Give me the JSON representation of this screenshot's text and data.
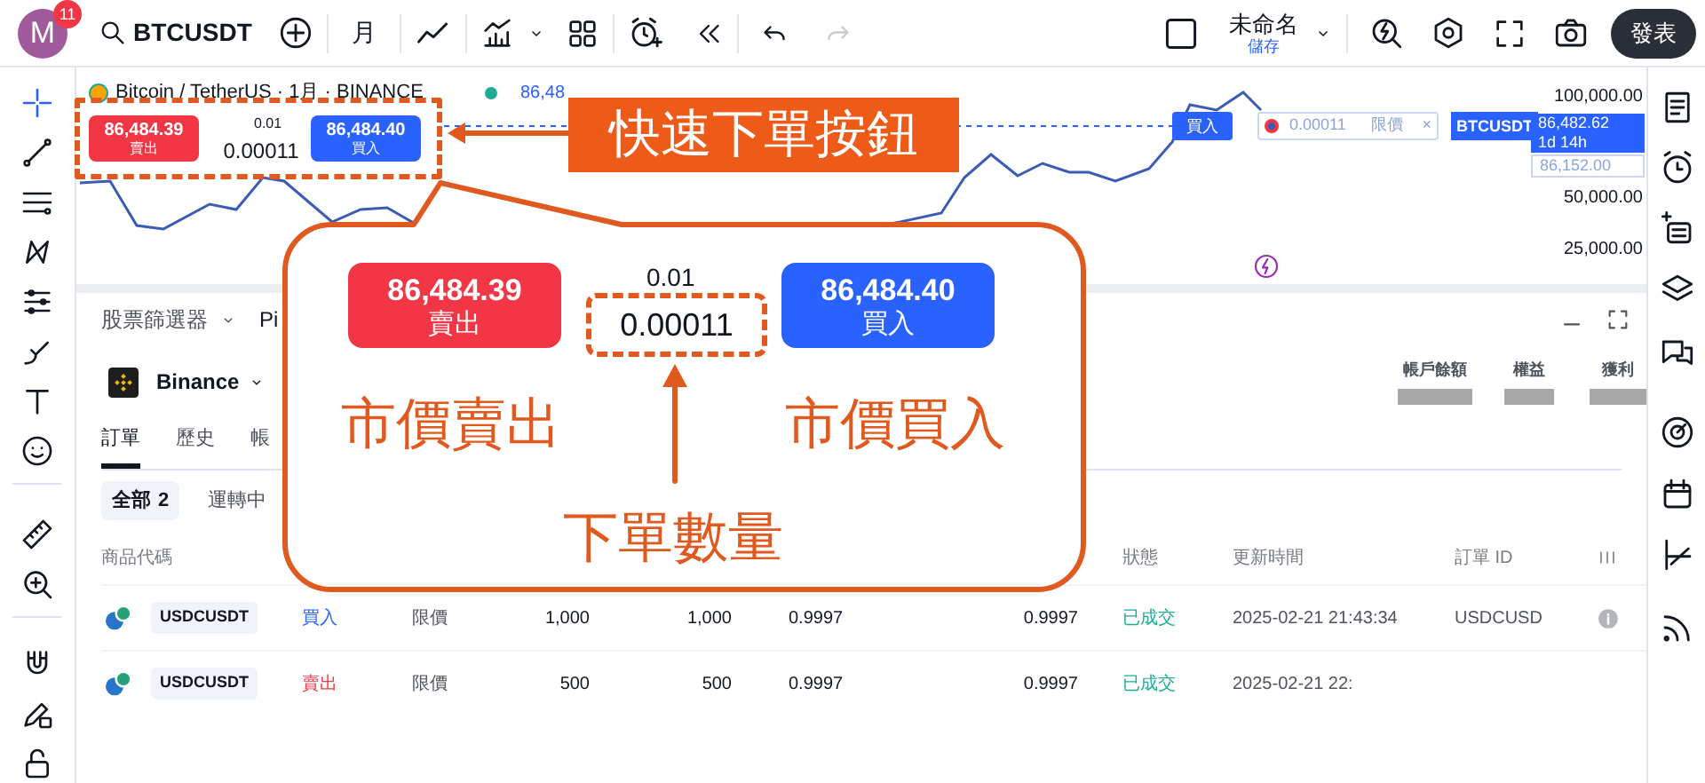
{
  "top_bar": {
    "avatar_letter": "M",
    "notification_count": "11",
    "symbol": "BTCUSDT",
    "interval": "月",
    "layout_name": "未命名",
    "save_label": "儲存",
    "publish_button": "發表"
  },
  "chart": {
    "legend": "Bitcoin / TetherUS · 1月 · BINANCE",
    "legend_price": "86,48",
    "quick_order": {
      "sell_price": "86,484.39",
      "sell_label": "賣出",
      "step": "0.01",
      "quantity": "0.00011",
      "buy_price": "86,484.40",
      "buy_label": "買入"
    },
    "order_line": {
      "side": "買入",
      "quantity": "0.00011",
      "type": "限價",
      "close": "×",
      "symbol": "BTCUSDT"
    },
    "price_axis": [
      "100,000.00",
      "50,000.00",
      "25,000.00"
    ],
    "last_price": {
      "price": "86,482.62",
      "countdown": "1d 14h"
    },
    "order_price": "86,152.00"
  },
  "panel": {
    "top_tabs": [
      "股票篩選器",
      "Pi"
    ],
    "broker": "Binance",
    "tabs": [
      {
        "label": "訂單",
        "selected": true
      },
      {
        "label": "歷史",
        "selected": false
      },
      {
        "label": "帳",
        "selected": false
      }
    ],
    "filters": [
      {
        "label": "全部",
        "count": "2",
        "selected": true
      },
      {
        "label": "運轉中",
        "selected": false
      }
    ],
    "account": [
      "帳戶餘額",
      "權益",
      "獲利"
    ],
    "columns": [
      "商品代碼",
      "狀態",
      "更新時間",
      "訂單 ID"
    ],
    "rows": [
      {
        "symbol": "USDCUSDT",
        "side": "買入",
        "kind": "buy",
        "type": "限價",
        "quantity": "1,000",
        "filled": "1,000",
        "price": "0.9997",
        "avg_price": "0.9997",
        "status": "已成交",
        "time": "2025-02-21 21:43:34",
        "order_id": "USDCUSD",
        "info": true
      },
      {
        "symbol": "USDCUSDT",
        "side": "賣出",
        "kind": "sell",
        "type": "限價",
        "quantity": "500",
        "filled": "500",
        "price": "0.9997",
        "avg_price": "0.9997",
        "status": "已成交",
        "time": "2025-02-21 22:",
        "info": false
      }
    ]
  },
  "annotations": {
    "callout": "快速下單按鈕",
    "zoom": {
      "sell_price": "86,484.39",
      "sell_label": "賣出",
      "step": "0.01",
      "quantity": "0.00011",
      "buy_price": "86,484.40",
      "buy_label": "買入"
    },
    "sell_note": "市價賣出",
    "buy_note": "市價買入",
    "quantity_note": "下單數量"
  }
}
